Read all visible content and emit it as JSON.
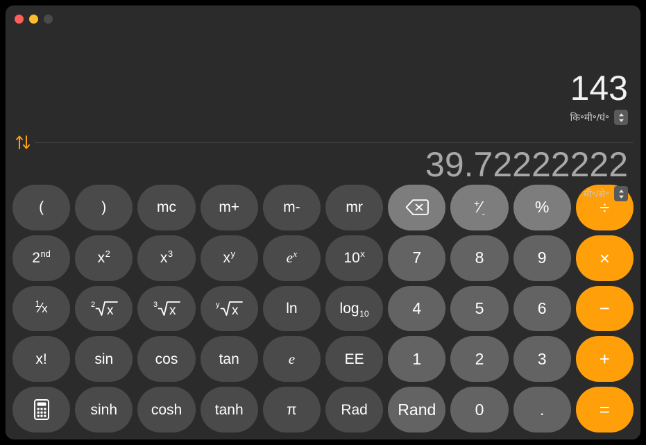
{
  "window": {
    "traffic_lights": [
      {
        "name": "close",
        "color": "#ff5f57"
      },
      {
        "name": "minimize",
        "color": "#febc2e"
      },
      {
        "name": "zoom",
        "color": "#4a4a4a"
      }
    ],
    "background": "#2b2b2b"
  },
  "display": {
    "input": {
      "value": "143",
      "unit": "कि॰मी॰/घं॰",
      "stepper": "stepper-up-down-icon"
    },
    "output": {
      "value": "39.72222222",
      "unit": "मी॰/से॰",
      "stepper": "stepper-up-down-icon"
    },
    "swap": {
      "icon": "swap-arrows-icon",
      "color": "#ff9f0a"
    }
  },
  "colors": {
    "function_key": "#4a4a4a",
    "utility_key": "#7d7d7d",
    "number_key": "#636363",
    "operator_key": "#ff9f0a",
    "accent": "#ff9f0a"
  },
  "keypad": {
    "rows": [
      [
        {
          "id": "open-paren",
          "label": "(",
          "type": "fn"
        },
        {
          "id": "close-paren",
          "label": ")",
          "type": "fn"
        },
        {
          "id": "memory-clear",
          "label": "mc",
          "type": "fn"
        },
        {
          "id": "memory-add",
          "label": "m+",
          "type": "fn"
        },
        {
          "id": "memory-sub",
          "label": "m-",
          "type": "fn"
        },
        {
          "id": "memory-recall",
          "label": "mr",
          "type": "fn"
        },
        {
          "id": "delete",
          "label": "",
          "type": "util",
          "icon": "backspace-delete-icon"
        },
        {
          "id": "sign-toggle",
          "label": "+⁄-",
          "type": "util"
        },
        {
          "id": "percent",
          "label": "%",
          "type": "util"
        },
        {
          "id": "divide",
          "label": "÷",
          "type": "op"
        }
      ],
      [
        {
          "id": "second",
          "label": "2nd",
          "type": "fn",
          "base": "2",
          "sup": "nd"
        },
        {
          "id": "square",
          "label": "x2",
          "type": "fn",
          "base": "x",
          "sup": "2"
        },
        {
          "id": "cube",
          "label": "x3",
          "type": "fn",
          "base": "x",
          "sup": "3"
        },
        {
          "id": "power-y",
          "label": "xy",
          "type": "fn",
          "base": "x",
          "sup": "y"
        },
        {
          "id": "exp-e",
          "label": "ex",
          "type": "fn",
          "base": "e",
          "sup": "x",
          "italic": true
        },
        {
          "id": "exp-ten",
          "label": "10x",
          "type": "fn",
          "base": "10",
          "sup": "x"
        },
        {
          "id": "digit-7",
          "label": "7",
          "type": "num"
        },
        {
          "id": "digit-8",
          "label": "8",
          "type": "num"
        },
        {
          "id": "digit-9",
          "label": "9",
          "type": "num"
        },
        {
          "id": "multiply",
          "label": "×",
          "type": "op"
        }
      ],
      [
        {
          "id": "reciprocal",
          "label": "1/x",
          "type": "fn"
        },
        {
          "id": "square-root",
          "label": "2√x",
          "type": "fn",
          "index": "2"
        },
        {
          "id": "cube-root",
          "label": "3√x",
          "type": "fn",
          "index": "3"
        },
        {
          "id": "nth-root",
          "label": "y√x",
          "type": "fn",
          "index": "y"
        },
        {
          "id": "natural-log",
          "label": "ln",
          "type": "fn"
        },
        {
          "id": "log-base-10",
          "label": "log10",
          "type": "fn",
          "base": "log",
          "sub": "10"
        },
        {
          "id": "digit-4",
          "label": "4",
          "type": "num"
        },
        {
          "id": "digit-5",
          "label": "5",
          "type": "num"
        },
        {
          "id": "digit-6",
          "label": "6",
          "type": "num"
        },
        {
          "id": "subtract",
          "label": "−",
          "type": "op"
        }
      ],
      [
        {
          "id": "factorial",
          "label": "x!",
          "type": "fn"
        },
        {
          "id": "sine",
          "label": "sin",
          "type": "fn"
        },
        {
          "id": "cosine",
          "label": "cos",
          "type": "fn"
        },
        {
          "id": "tangent",
          "label": "tan",
          "type": "fn"
        },
        {
          "id": "euler-e",
          "label": "e",
          "type": "fn",
          "italic": true
        },
        {
          "id": "exponent-ee",
          "label": "EE",
          "type": "fn"
        },
        {
          "id": "digit-1",
          "label": "1",
          "type": "num"
        },
        {
          "id": "digit-2",
          "label": "2",
          "type": "num"
        },
        {
          "id": "digit-3",
          "label": "3",
          "type": "num"
        },
        {
          "id": "add",
          "label": "+",
          "type": "op"
        }
      ],
      [
        {
          "id": "basic-mode",
          "label": "",
          "type": "fn",
          "icon": "calculator-icon"
        },
        {
          "id": "hyp-sine",
          "label": "sinh",
          "type": "fn"
        },
        {
          "id": "hyp-cosine",
          "label": "cosh",
          "type": "fn"
        },
        {
          "id": "hyp-tangent",
          "label": "tanh",
          "type": "fn"
        },
        {
          "id": "pi",
          "label": "π",
          "type": "fn"
        },
        {
          "id": "radians",
          "label": "Rad",
          "type": "fn"
        },
        {
          "id": "random",
          "label": "Rand",
          "type": "num"
        },
        {
          "id": "digit-0",
          "label": "0",
          "type": "num"
        },
        {
          "id": "decimal",
          "label": ".",
          "type": "num"
        },
        {
          "id": "equals",
          "label": "=",
          "type": "op"
        }
      ]
    ]
  }
}
